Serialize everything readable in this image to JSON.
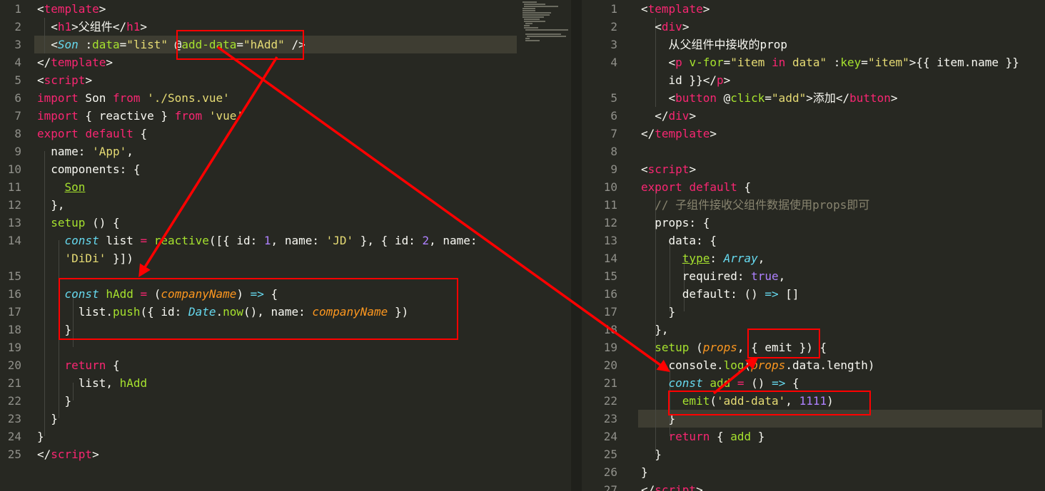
{
  "left_editor": {
    "lines": [
      {
        "n": "1",
        "tokens": [
          {
            "t": "<",
            "c": "plain"
          },
          {
            "t": "template",
            "c": "tag"
          },
          {
            "t": ">",
            "c": "plain"
          }
        ]
      },
      {
        "n": "2",
        "tokens": [
          {
            "t": "  <",
            "c": "plain"
          },
          {
            "t": "h1",
            "c": "tag"
          },
          {
            "t": ">父组件</",
            "c": "plain"
          },
          {
            "t": "h1",
            "c": "tag"
          },
          {
            "t": ">",
            "c": "plain"
          }
        ]
      },
      {
        "n": "3",
        "tokens": [
          {
            "t": "  <",
            "c": "plain"
          },
          {
            "t": "Son",
            "c": "cls"
          },
          {
            "t": " :",
            "c": "plain"
          },
          {
            "t": "data",
            "c": "attr"
          },
          {
            "t": "=",
            "c": "plain"
          },
          {
            "t": "\"list\"",
            "c": "str"
          },
          {
            "t": " @",
            "c": "plain"
          },
          {
            "t": "add-data",
            "c": "attr"
          },
          {
            "t": "=",
            "c": "plain"
          },
          {
            "t": "\"hAdd\"",
            "c": "str"
          },
          {
            "t": " />",
            "c": "plain"
          }
        ]
      },
      {
        "n": "4",
        "tokens": [
          {
            "t": "</",
            "c": "plain"
          },
          {
            "t": "template",
            "c": "tag"
          },
          {
            "t": ">",
            "c": "plain"
          }
        ]
      },
      {
        "n": "5",
        "tokens": [
          {
            "t": "<",
            "c": "plain"
          },
          {
            "t": "script",
            "c": "tag"
          },
          {
            "t": ">",
            "c": "plain"
          }
        ]
      },
      {
        "n": "6",
        "tokens": [
          {
            "t": "import",
            "c": "kw"
          },
          {
            "t": " Son ",
            "c": "plain"
          },
          {
            "t": "from",
            "c": "kw"
          },
          {
            "t": " ",
            "c": "plain"
          },
          {
            "t": "'./Sons.vue'",
            "c": "str"
          }
        ]
      },
      {
        "n": "7",
        "tokens": [
          {
            "t": "import",
            "c": "kw"
          },
          {
            "t": " { reactive } ",
            "c": "plain"
          },
          {
            "t": "from",
            "c": "kw"
          },
          {
            "t": " ",
            "c": "plain"
          },
          {
            "t": "'vue'",
            "c": "str"
          }
        ]
      },
      {
        "n": "8",
        "tokens": [
          {
            "t": "export",
            "c": "kw"
          },
          {
            "t": " ",
            "c": "plain"
          },
          {
            "t": "default",
            "c": "kw"
          },
          {
            "t": " {",
            "c": "plain"
          }
        ]
      },
      {
        "n": "9",
        "tokens": [
          {
            "t": "  name: ",
            "c": "plain"
          },
          {
            "t": "'App'",
            "c": "str"
          },
          {
            "t": ",",
            "c": "plain"
          }
        ]
      },
      {
        "n": "10",
        "tokens": [
          {
            "t": "  components: {",
            "c": "plain"
          }
        ]
      },
      {
        "n": "11",
        "tokens": [
          {
            "t": "    ",
            "c": "plain"
          },
          {
            "t": "Son",
            "c": "ulfn"
          }
        ]
      },
      {
        "n": "12",
        "tokens": [
          {
            "t": "  },",
            "c": "plain"
          }
        ]
      },
      {
        "n": "13",
        "tokens": [
          {
            "t": "  ",
            "c": "plain"
          },
          {
            "t": "setup",
            "c": "fn"
          },
          {
            "t": " () {",
            "c": "plain"
          }
        ]
      },
      {
        "n": "14",
        "tokens": [
          {
            "t": "    ",
            "c": "plain"
          },
          {
            "t": "const",
            "c": "cls"
          },
          {
            "t": " list ",
            "c": "plain"
          },
          {
            "t": "=",
            "c": "kw"
          },
          {
            "t": " ",
            "c": "plain"
          },
          {
            "t": "reactive",
            "c": "fn"
          },
          {
            "t": "([{ id: ",
            "c": "plain"
          },
          {
            "t": "1",
            "c": "num"
          },
          {
            "t": ", name: ",
            "c": "plain"
          },
          {
            "t": "'JD'",
            "c": "str"
          },
          {
            "t": " }, { id: ",
            "c": "plain"
          },
          {
            "t": "2",
            "c": "num"
          },
          {
            "t": ", name:",
            "c": "plain"
          }
        ]
      },
      {
        "n": "",
        "tokens": [
          {
            "t": "    ",
            "c": "plain"
          },
          {
            "t": "'DiDi'",
            "c": "str"
          },
          {
            "t": " }])",
            "c": "plain"
          }
        ]
      },
      {
        "n": "15",
        "tokens": []
      },
      {
        "n": "16",
        "tokens": [
          {
            "t": "    ",
            "c": "plain"
          },
          {
            "t": "const",
            "c": "cls"
          },
          {
            "t": " ",
            "c": "plain"
          },
          {
            "t": "hAdd",
            "c": "fn"
          },
          {
            "t": " ",
            "c": "plain"
          },
          {
            "t": "=",
            "c": "kw"
          },
          {
            "t": " (",
            "c": "plain"
          },
          {
            "t": "companyName",
            "c": "param"
          },
          {
            "t": ") ",
            "c": "plain"
          },
          {
            "t": "=>",
            "c": "cls"
          },
          {
            "t": " {",
            "c": "plain"
          }
        ]
      },
      {
        "n": "17",
        "tokens": [
          {
            "t": "      list.",
            "c": "plain"
          },
          {
            "t": "push",
            "c": "fn"
          },
          {
            "t": "({ id: ",
            "c": "plain"
          },
          {
            "t": "Date",
            "c": "cls"
          },
          {
            "t": ".",
            "c": "plain"
          },
          {
            "t": "now",
            "c": "fn"
          },
          {
            "t": "(), name: ",
            "c": "plain"
          },
          {
            "t": "companyName",
            "c": "param"
          },
          {
            "t": " })",
            "c": "plain"
          }
        ]
      },
      {
        "n": "18",
        "tokens": [
          {
            "t": "    }",
            "c": "plain"
          }
        ]
      },
      {
        "n": "19",
        "tokens": []
      },
      {
        "n": "20",
        "tokens": [
          {
            "t": "    ",
            "c": "plain"
          },
          {
            "t": "return",
            "c": "kw"
          },
          {
            "t": " {",
            "c": "plain"
          }
        ]
      },
      {
        "n": "21",
        "tokens": [
          {
            "t": "      list, ",
            "c": "plain"
          },
          {
            "t": "hAdd",
            "c": "fn"
          }
        ]
      },
      {
        "n": "22",
        "tokens": [
          {
            "t": "    }",
            "c": "plain"
          }
        ]
      },
      {
        "n": "23",
        "tokens": [
          {
            "t": "  }",
            "c": "plain"
          }
        ]
      },
      {
        "n": "24",
        "tokens": [
          {
            "t": "}",
            "c": "plain"
          }
        ]
      },
      {
        "n": "25",
        "tokens": [
          {
            "t": "</",
            "c": "plain"
          },
          {
            "t": "script",
            "c": "tag"
          },
          {
            "t": ">",
            "c": "plain"
          }
        ]
      }
    ]
  },
  "right_editor": {
    "lines": [
      {
        "n": "1",
        "tokens": [
          {
            "t": "<",
            "c": "plain"
          },
          {
            "t": "template",
            "c": "tag"
          },
          {
            "t": ">",
            "c": "plain"
          }
        ]
      },
      {
        "n": "2",
        "tokens": [
          {
            "t": "  <",
            "c": "plain"
          },
          {
            "t": "div",
            "c": "tag"
          },
          {
            "t": ">",
            "c": "plain"
          }
        ]
      },
      {
        "n": "3",
        "tokens": [
          {
            "t": "    从父组件中接收的prop",
            "c": "plain"
          }
        ]
      },
      {
        "n": "4",
        "tokens": [
          {
            "t": "    <",
            "c": "plain"
          },
          {
            "t": "p",
            "c": "tag"
          },
          {
            "t": " ",
            "c": "plain"
          },
          {
            "t": "v-for",
            "c": "attr"
          },
          {
            "t": "=",
            "c": "plain"
          },
          {
            "t": "\"item ",
            "c": "str"
          },
          {
            "t": "in",
            "c": "kw"
          },
          {
            "t": " data\"",
            "c": "str"
          },
          {
            "t": " :",
            "c": "plain"
          },
          {
            "t": "key",
            "c": "attr"
          },
          {
            "t": "=",
            "c": "plain"
          },
          {
            "t": "\"item\"",
            "c": "str"
          },
          {
            "t": ">{{ item.name }}",
            "c": "plain"
          }
        ]
      },
      {
        "n": "",
        "tokens": [
          {
            "t": "    id }}</",
            "c": "plain"
          },
          {
            "t": "p",
            "c": "tag"
          },
          {
            "t": ">",
            "c": "plain"
          }
        ]
      },
      {
        "n": "5",
        "tokens": [
          {
            "t": "    <",
            "c": "plain"
          },
          {
            "t": "button",
            "c": "tag"
          },
          {
            "t": " @",
            "c": "plain"
          },
          {
            "t": "click",
            "c": "attr"
          },
          {
            "t": "=",
            "c": "plain"
          },
          {
            "t": "\"add\"",
            "c": "str"
          },
          {
            "t": ">添加</",
            "c": "plain"
          },
          {
            "t": "button",
            "c": "tag"
          },
          {
            "t": ">",
            "c": "plain"
          }
        ]
      },
      {
        "n": "6",
        "tokens": [
          {
            "t": "  </",
            "c": "plain"
          },
          {
            "t": "div",
            "c": "tag"
          },
          {
            "t": ">",
            "c": "plain"
          }
        ]
      },
      {
        "n": "7",
        "tokens": [
          {
            "t": "</",
            "c": "plain"
          },
          {
            "t": "template",
            "c": "tag"
          },
          {
            "t": ">",
            "c": "plain"
          }
        ]
      },
      {
        "n": "8",
        "tokens": []
      },
      {
        "n": "9",
        "tokens": [
          {
            "t": "<",
            "c": "plain"
          },
          {
            "t": "script",
            "c": "tag"
          },
          {
            "t": ">",
            "c": "plain"
          }
        ]
      },
      {
        "n": "10",
        "tokens": [
          {
            "t": "export",
            "c": "kw"
          },
          {
            "t": " ",
            "c": "plain"
          },
          {
            "t": "default",
            "c": "kw"
          },
          {
            "t": " {",
            "c": "plain"
          }
        ]
      },
      {
        "n": "11",
        "tokens": [
          {
            "t": "  // 子组件接收父组件数据使用props即可",
            "c": "cmt"
          }
        ]
      },
      {
        "n": "12",
        "tokens": [
          {
            "t": "  props: {",
            "c": "plain"
          }
        ]
      },
      {
        "n": "13",
        "tokens": [
          {
            "t": "    data: {",
            "c": "plain"
          }
        ]
      },
      {
        "n": "14",
        "tokens": [
          {
            "t": "      ",
            "c": "plain"
          },
          {
            "t": "type",
            "c": "ulfn"
          },
          {
            "t": ": ",
            "c": "plain"
          },
          {
            "t": "Array",
            "c": "cls"
          },
          {
            "t": ",",
            "c": "plain"
          }
        ]
      },
      {
        "n": "15",
        "tokens": [
          {
            "t": "      required: ",
            "c": "plain"
          },
          {
            "t": "true",
            "c": "num"
          },
          {
            "t": ",",
            "c": "plain"
          }
        ]
      },
      {
        "n": "16",
        "tokens": [
          {
            "t": "      default: () ",
            "c": "plain"
          },
          {
            "t": "=>",
            "c": "cls"
          },
          {
            "t": " []",
            "c": "plain"
          }
        ]
      },
      {
        "n": "17",
        "tokens": [
          {
            "t": "    }",
            "c": "plain"
          }
        ]
      },
      {
        "n": "18",
        "tokens": [
          {
            "t": "  },",
            "c": "plain"
          }
        ]
      },
      {
        "n": "19",
        "tokens": [
          {
            "t": "  ",
            "c": "plain"
          },
          {
            "t": "setup",
            "c": "fn"
          },
          {
            "t": " (",
            "c": "plain"
          },
          {
            "t": "props",
            "c": "param"
          },
          {
            "t": ", { emit }) {",
            "c": "plain"
          }
        ]
      },
      {
        "n": "20",
        "tokens": [
          {
            "t": "    console.",
            "c": "plain"
          },
          {
            "t": "log",
            "c": "fn"
          },
          {
            "t": "(",
            "c": "plain"
          },
          {
            "t": "props",
            "c": "param"
          },
          {
            "t": ".data.length)",
            "c": "plain"
          }
        ]
      },
      {
        "n": "21",
        "tokens": [
          {
            "t": "    ",
            "c": "plain"
          },
          {
            "t": "const",
            "c": "cls"
          },
          {
            "t": " ",
            "c": "plain"
          },
          {
            "t": "add",
            "c": "fn"
          },
          {
            "t": " ",
            "c": "plain"
          },
          {
            "t": "=",
            "c": "kw"
          },
          {
            "t": " () ",
            "c": "plain"
          },
          {
            "t": "=>",
            "c": "cls"
          },
          {
            "t": " {",
            "c": "plain"
          }
        ]
      },
      {
        "n": "22",
        "tokens": [
          {
            "t": "      ",
            "c": "plain"
          },
          {
            "t": "emit",
            "c": "fn"
          },
          {
            "t": "(",
            "c": "plain"
          },
          {
            "t": "'add-data'",
            "c": "str"
          },
          {
            "t": ", ",
            "c": "plain"
          },
          {
            "t": "1111",
            "c": "num"
          },
          {
            "t": ")",
            "c": "plain"
          }
        ]
      },
      {
        "n": "23",
        "tokens": [
          {
            "t": "    }",
            "c": "plain"
          }
        ]
      },
      {
        "n": "24",
        "tokens": [
          {
            "t": "    ",
            "c": "plain"
          },
          {
            "t": "return",
            "c": "kw"
          },
          {
            "t": " { ",
            "c": "plain"
          },
          {
            "t": "add",
            "c": "fn"
          },
          {
            "t": " }",
            "c": "plain"
          }
        ]
      },
      {
        "n": "25",
        "tokens": [
          {
            "t": "  }",
            "c": "plain"
          }
        ]
      },
      {
        "n": "26",
        "tokens": [
          {
            "t": "}",
            "c": "plain"
          }
        ]
      },
      {
        "n": "27",
        "tokens": [
          {
            "t": "</",
            "c": "plain"
          },
          {
            "t": "script",
            "c": "tag"
          },
          {
            "t": ">",
            "c": "plain"
          }
        ]
      }
    ]
  },
  "colors": {
    "background": "#272822",
    "annotation": "#ff0000",
    "tag": "#f92672",
    "string": "#e6db74",
    "function": "#a6e22e",
    "storage": "#66d9ef",
    "number": "#ae81ff",
    "parameter": "#fd971f",
    "comment": "#88846f"
  }
}
